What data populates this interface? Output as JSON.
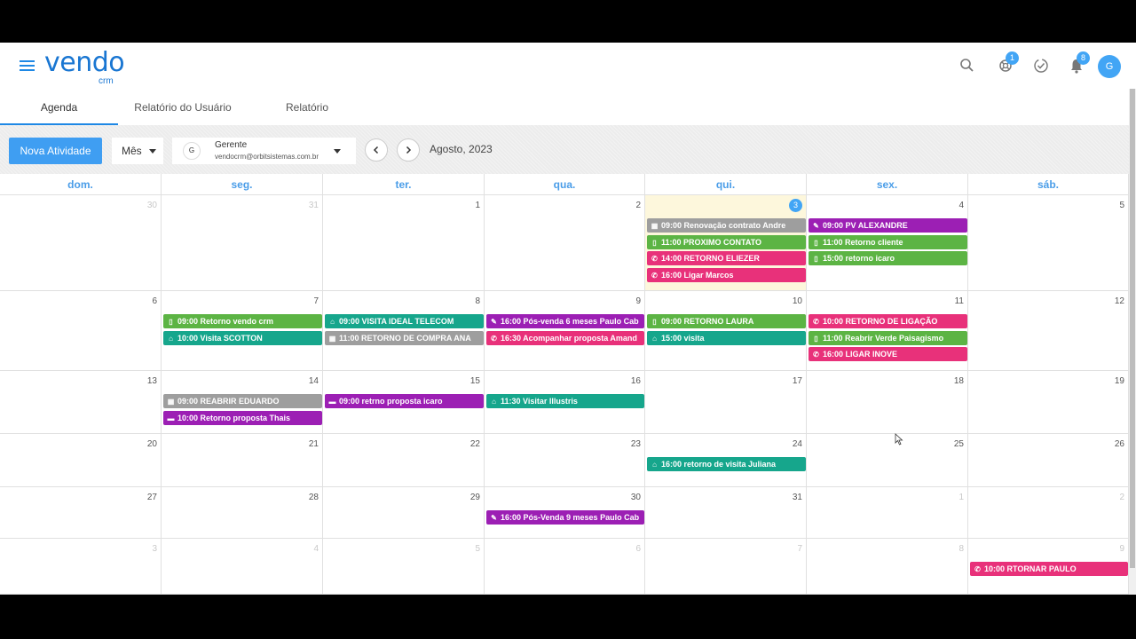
{
  "app": {
    "logo": "vendo",
    "logo_sub": "crm"
  },
  "header": {
    "icons": [
      "search-icon",
      "support-icon",
      "check-icon",
      "bell-icon"
    ],
    "support_badge": "1",
    "notification_badge": "8",
    "avatar_initial": "G"
  },
  "tabs": [
    "Agenda",
    "Relatório do Usuário",
    "Relatório"
  ],
  "toolbar": {
    "new_activity": "Nova Atividade",
    "view": "Mês",
    "user_initial": "G",
    "user_name": "Gerente",
    "user_email": "vendocrm@orbitsistemas.com.br",
    "month_label": "Agosto, 2023"
  },
  "calendar": {
    "weekdays": [
      "dom.",
      "seg.",
      "ter.",
      "qua.",
      "qui.",
      "sex.",
      "sáb."
    ],
    "weeks": [
      [
        "30",
        "31",
        "1",
        "2",
        "3",
        "4",
        "5"
      ],
      [
        "6",
        "7",
        "8",
        "9",
        "10",
        "11",
        "12"
      ],
      [
        "13",
        "14",
        "15",
        "16",
        "17",
        "18",
        "19"
      ],
      [
        "20",
        "21",
        "22",
        "23",
        "24",
        "25",
        "26"
      ],
      [
        "27",
        "28",
        "29",
        "30",
        "31",
        "1",
        "2"
      ],
      [
        "3",
        "4",
        "5",
        "6",
        "7",
        "8",
        "9"
      ]
    ],
    "events": [
      {
        "week": 0,
        "day": 4,
        "slot": 0,
        "color": "gray",
        "icon": "calendar",
        "text": "09:00 Renovação contrato Andre"
      },
      {
        "week": 0,
        "day": 4,
        "slot": 1,
        "color": "green",
        "icon": "phone-mobile",
        "text": "11:00 PROXIMO CONTATO"
      },
      {
        "week": 0,
        "day": 4,
        "slot": 2,
        "color": "pink",
        "icon": "phone",
        "text": "14:00 RETORNO ELIEZER"
      },
      {
        "week": 0,
        "day": 4,
        "slot": 3,
        "color": "pink",
        "icon": "phone",
        "text": "16:00 Ligar Marcos"
      },
      {
        "week": 0,
        "day": 5,
        "slot": 0,
        "color": "purple",
        "icon": "wrench",
        "text": "09:00 PV ALEXANDRE"
      },
      {
        "week": 0,
        "day": 5,
        "slot": 1,
        "color": "green",
        "icon": "phone-mobile",
        "text": "11:00 Retorno cliente"
      },
      {
        "week": 0,
        "day": 5,
        "slot": 2,
        "color": "green",
        "icon": "phone-mobile",
        "text": "15:00 retorno icaro"
      },
      {
        "week": 1,
        "day": 1,
        "slot": 0,
        "color": "green",
        "icon": "phone-mobile",
        "text": "09:00 Retorno vendo crm"
      },
      {
        "week": 1,
        "day": 1,
        "slot": 1,
        "color": "teal",
        "icon": "home",
        "text": "10:00 Visita SCOTTON"
      },
      {
        "week": 1,
        "day": 2,
        "slot": 0,
        "color": "teal",
        "icon": "home",
        "text": "09:00 VISITA IDEAL TELECOM"
      },
      {
        "week": 1,
        "day": 2,
        "slot": 1,
        "color": "gray",
        "icon": "calendar",
        "text": "11:00 RETORNO DE COMPRA ANA"
      },
      {
        "week": 1,
        "day": 3,
        "slot": 0,
        "color": "purple",
        "icon": "wrench",
        "text": "16:00 Pós-venda 6 meses Paulo Cab"
      },
      {
        "week": 1,
        "day": 3,
        "slot": 1,
        "color": "pink",
        "icon": "phone",
        "text": "16:30 Acompanhar proposta Amand"
      },
      {
        "week": 1,
        "day": 4,
        "slot": 0,
        "color": "green",
        "icon": "phone-mobile",
        "text": "09:00 RETORNO LAURA"
      },
      {
        "week": 1,
        "day": 4,
        "slot": 1,
        "color": "teal",
        "icon": "home",
        "text": "15:00 visita"
      },
      {
        "week": 1,
        "day": 5,
        "slot": 0,
        "color": "pink",
        "icon": "phone",
        "text": "10:00 RETORNO DE LIGAÇÃO"
      },
      {
        "week": 1,
        "day": 5,
        "slot": 1,
        "color": "green",
        "icon": "phone-mobile",
        "text": "11:00 Reabrir Verde Paisagismo"
      },
      {
        "week": 1,
        "day": 5,
        "slot": 2,
        "color": "pink",
        "icon": "phone",
        "text": "16:00 LIGAR INOVE"
      },
      {
        "week": 2,
        "day": 1,
        "slot": 0,
        "color": "gray",
        "icon": "calendar",
        "text": "09:00 REABRIR EDUARDO"
      },
      {
        "week": 2,
        "day": 1,
        "slot": 1,
        "color": "purple",
        "icon": "document",
        "text": "10:00 Retorno proposta Thais"
      },
      {
        "week": 2,
        "day": 2,
        "slot": 0,
        "color": "purple",
        "icon": "document",
        "text": "09:00 retrno proposta icaro"
      },
      {
        "week": 2,
        "day": 3,
        "slot": 0,
        "color": "teal",
        "icon": "home",
        "text": "11:30 Visitar Illustris"
      },
      {
        "week": 3,
        "day": 4,
        "slot": 0,
        "color": "teal",
        "icon": "home",
        "text": "16:00 retorno de visita Juliana"
      },
      {
        "week": 4,
        "day": 3,
        "slot": 0,
        "color": "purple",
        "icon": "wrench",
        "text": "16:00 Pós-Venda 9 meses Paulo Cab"
      },
      {
        "week": 5,
        "day": 6,
        "slot": 0,
        "color": "pink",
        "icon": "phone",
        "text": "10:00 RTORNAR PAULO"
      }
    ]
  }
}
